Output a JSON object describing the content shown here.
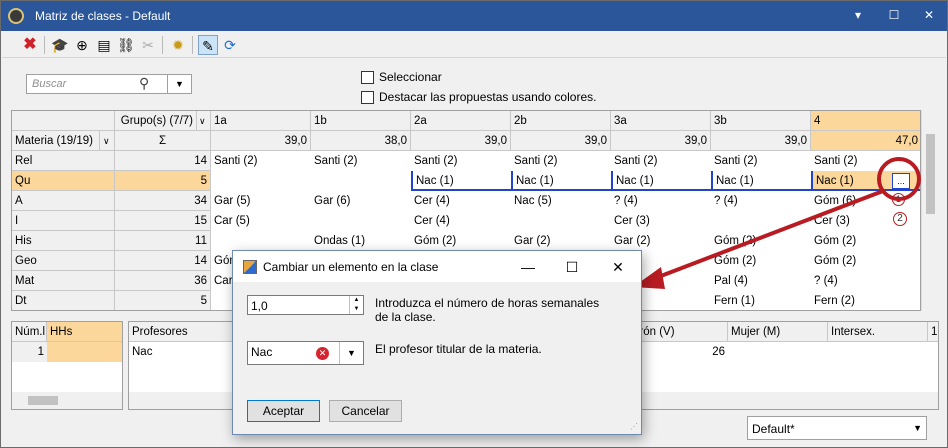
{
  "window": {
    "title": "Matriz de clases - Default",
    "min": "▾",
    "max": "☐",
    "close": "✕"
  },
  "toolbar": {
    "icons": [
      "delete-icon",
      "graduate-icon",
      "add-icon",
      "teacher-icon",
      "link-icon",
      "unlink-icon",
      "settings-icon",
      "edit-icon",
      "refresh-icon"
    ]
  },
  "search": {
    "placeholder": "Buscar"
  },
  "options": {
    "select_label": "Seleccionar",
    "highlight_label": "Destacar las propuestas usando colores."
  },
  "grid": {
    "groups_header": "Grupo(s) (7/7)",
    "subjects_header": "Materia (19/19)",
    "sigma": "Σ",
    "columns": [
      {
        "name": "1a",
        "total": "39,0"
      },
      {
        "name": "1b",
        "total": "38,0"
      },
      {
        "name": "2a",
        "total": "39,0"
      },
      {
        "name": "2b",
        "total": "39,0"
      },
      {
        "name": "3a",
        "total": "39,0"
      },
      {
        "name": "3b",
        "total": "39,0"
      },
      {
        "name": "4",
        "total": "47,0"
      }
    ],
    "rows": [
      {
        "subject": "Rel",
        "sum": "14",
        "cells": [
          "Santi (2)",
          "Santi (2)",
          "Santi (2)",
          "Santi (2)",
          "Santi (2)",
          "Santi (2)",
          "Santi (2)"
        ]
      },
      {
        "subject": "Qu",
        "sum": "5",
        "cells": [
          "",
          "",
          "Nac (1)",
          "Nac (1)",
          "Nac (1)",
          "Nac (1)",
          "Nac (1)"
        ]
      },
      {
        "subject": "A",
        "sum": "34",
        "cells": [
          "Gar (5)",
          "Gar (6)",
          "Cer (4)",
          "Nac (5)",
          "? (4)",
          "? (4)",
          "Góm (6)"
        ]
      },
      {
        "subject": "I",
        "sum": "15",
        "cells": [
          "Car (5)",
          "",
          "Cer (4)",
          "",
          "Cer (3)",
          "",
          "Cer (3)"
        ]
      },
      {
        "subject": "His",
        "sum": "11",
        "cells": [
          "",
          "Ondas (1)",
          "Góm (2)",
          "Gar (2)",
          "Gar (2)",
          "Góm (2)",
          "Góm (2)"
        ]
      },
      {
        "subject": "Geo",
        "sum": "14",
        "cells": [
          "Góm",
          "",
          "",
          "",
          "",
          "Góm (2)",
          "Góm (2)"
        ]
      },
      {
        "subject": "Mat",
        "sum": "36",
        "cells": [
          "Car",
          "",
          "",
          "",
          "",
          "Pal (4)",
          "? (4)"
        ]
      },
      {
        "subject": "Dt",
        "sum": "5",
        "cells": [
          "",
          "",
          "",
          "",
          "",
          "Fern (1)",
          "Fern (2)"
        ]
      }
    ],
    "cell_button": "...",
    "badge_1": "1",
    "badge_2": "2"
  },
  "bottom_left": {
    "headers": [
      "Núm.l",
      "HHs"
    ],
    "row_num": "1"
  },
  "bottom_mid": {
    "header": "Profesores",
    "value": "Nac"
  },
  "bottom_right": {
    "headers": [
      "arón (V)",
      "Mujer (M)",
      "Intersex.",
      "1"
    ],
    "value": "26"
  },
  "combo": {
    "value": "Default*"
  },
  "dialog": {
    "title": "Cambiar un elemento en la clase",
    "hours_value": "1,0",
    "hours_label": "Introduzca el número de horas semanales de la clase.",
    "teacher_value": "Nac",
    "teacher_label": "El profesor titular de la materia.",
    "accept": "Aceptar",
    "cancel": "Cancelar",
    "min": "—",
    "max": "☐",
    "close": "✕"
  },
  "colors": {
    "title_bar": "#2b579a",
    "highlight": "#fcd79c",
    "annotation": "#b81c22",
    "selection_line": "#2244cc"
  }
}
